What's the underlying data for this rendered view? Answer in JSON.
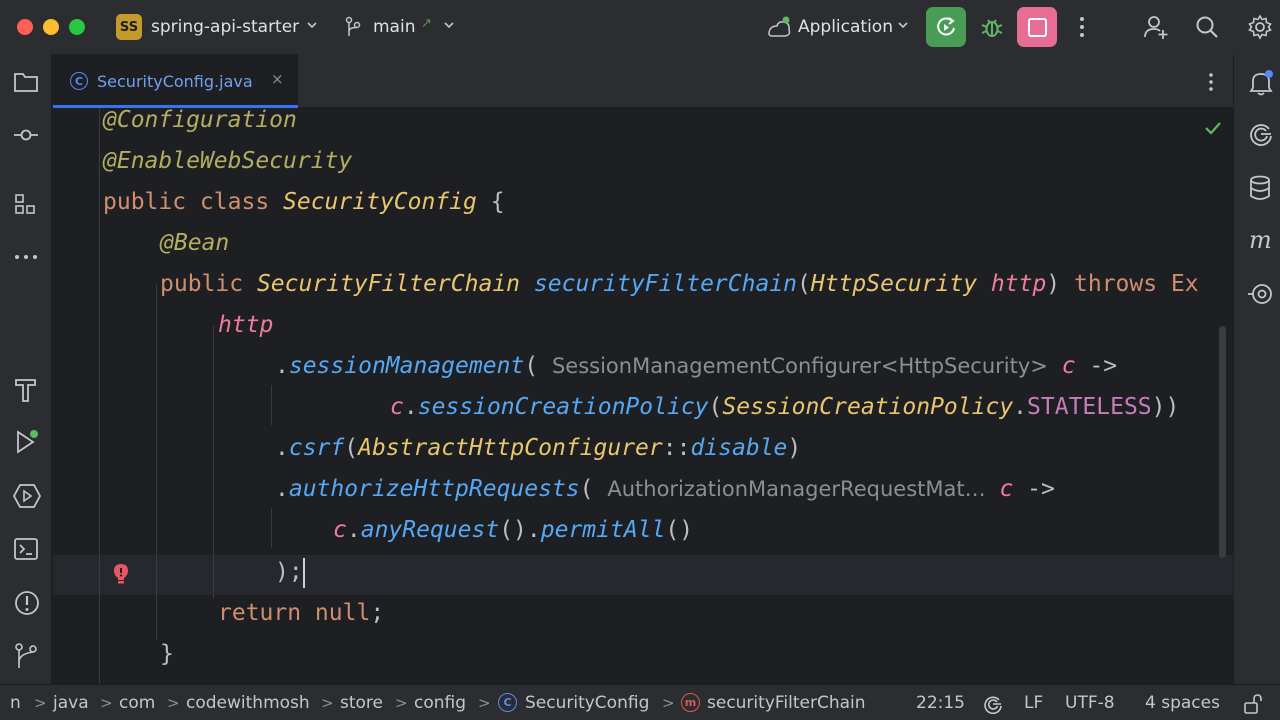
{
  "titlebar": {
    "project_badge": "SS",
    "project_name": "spring-api-starter",
    "branch": "main",
    "branch_arrow": "↗",
    "run_config": "Application"
  },
  "tab": {
    "icon_letter": "C",
    "label": "SecurityConfig.java",
    "close": "×"
  },
  "code": {
    "l1": [
      "@Configuration"
    ],
    "l2": [
      "@EnableWebSecurity"
    ],
    "l3": [
      "public class ",
      "SecurityConfig",
      " {"
    ],
    "l4": [
      "@Bean"
    ],
    "l5": [
      "public ",
      "SecurityFilterChain",
      " ",
      "securityFilterChain",
      "(",
      "HttpSecurity",
      " ",
      "http",
      ") ",
      "throws Ex"
    ],
    "l6": [
      "http"
    ],
    "l7": [
      ".",
      "sessionManagement",
      "( ",
      "SessionManagementConfigurer<HttpSecurity>",
      " ",
      "c",
      " ->"
    ],
    "l8": [
      "c",
      ".",
      "sessionCreationPolicy",
      "(",
      "SessionCreationPolicy",
      ".",
      "STATELESS",
      "))"
    ],
    "l9": [
      ".",
      "csrf",
      "(",
      "AbstractHttpConfigurer",
      "::",
      "disable",
      ")"
    ],
    "l10": [
      ".",
      "authorizeHttpRequests",
      "( ",
      "AuthorizationManagerRequestMat…",
      " ",
      "c",
      " ->"
    ],
    "l11": [
      "c",
      ".",
      "anyRequest",
      "().",
      "permitAll",
      "()"
    ],
    "l12": [
      ");"
    ],
    "l13": [
      "return null",
      ";"
    ],
    "l14": [
      "}"
    ]
  },
  "statusbar": {
    "crumb_n": "n",
    "crumb_java": "java",
    "crumb_com": "com",
    "crumb_codewithmosh": "codewithmosh",
    "crumb_store": "store",
    "crumb_config": "config",
    "class_icon_letter": "C",
    "crumb_class": "SecurityConfig",
    "method_icon_letter": "m",
    "crumb_method": "securityFilterChain",
    "caret": "22:15",
    "line_sep": "LF",
    "encoding": "UTF-8",
    "indent": "4 spaces",
    "sep": ">"
  },
  "colors": {
    "accent": "#3574f0",
    "run_green": "#499c54",
    "stop_pink": "#e76d95"
  },
  "icons": [
    "folder-icon",
    "commit-icon",
    "structure-icon",
    "more-icon",
    "build-icon",
    "run-icon",
    "services-icon",
    "terminal-icon",
    "problems-icon",
    "git-icon",
    "notifications-icon",
    "ai-assistant-icon",
    "database-icon",
    "maven-icon",
    "endpoints-icon"
  ]
}
